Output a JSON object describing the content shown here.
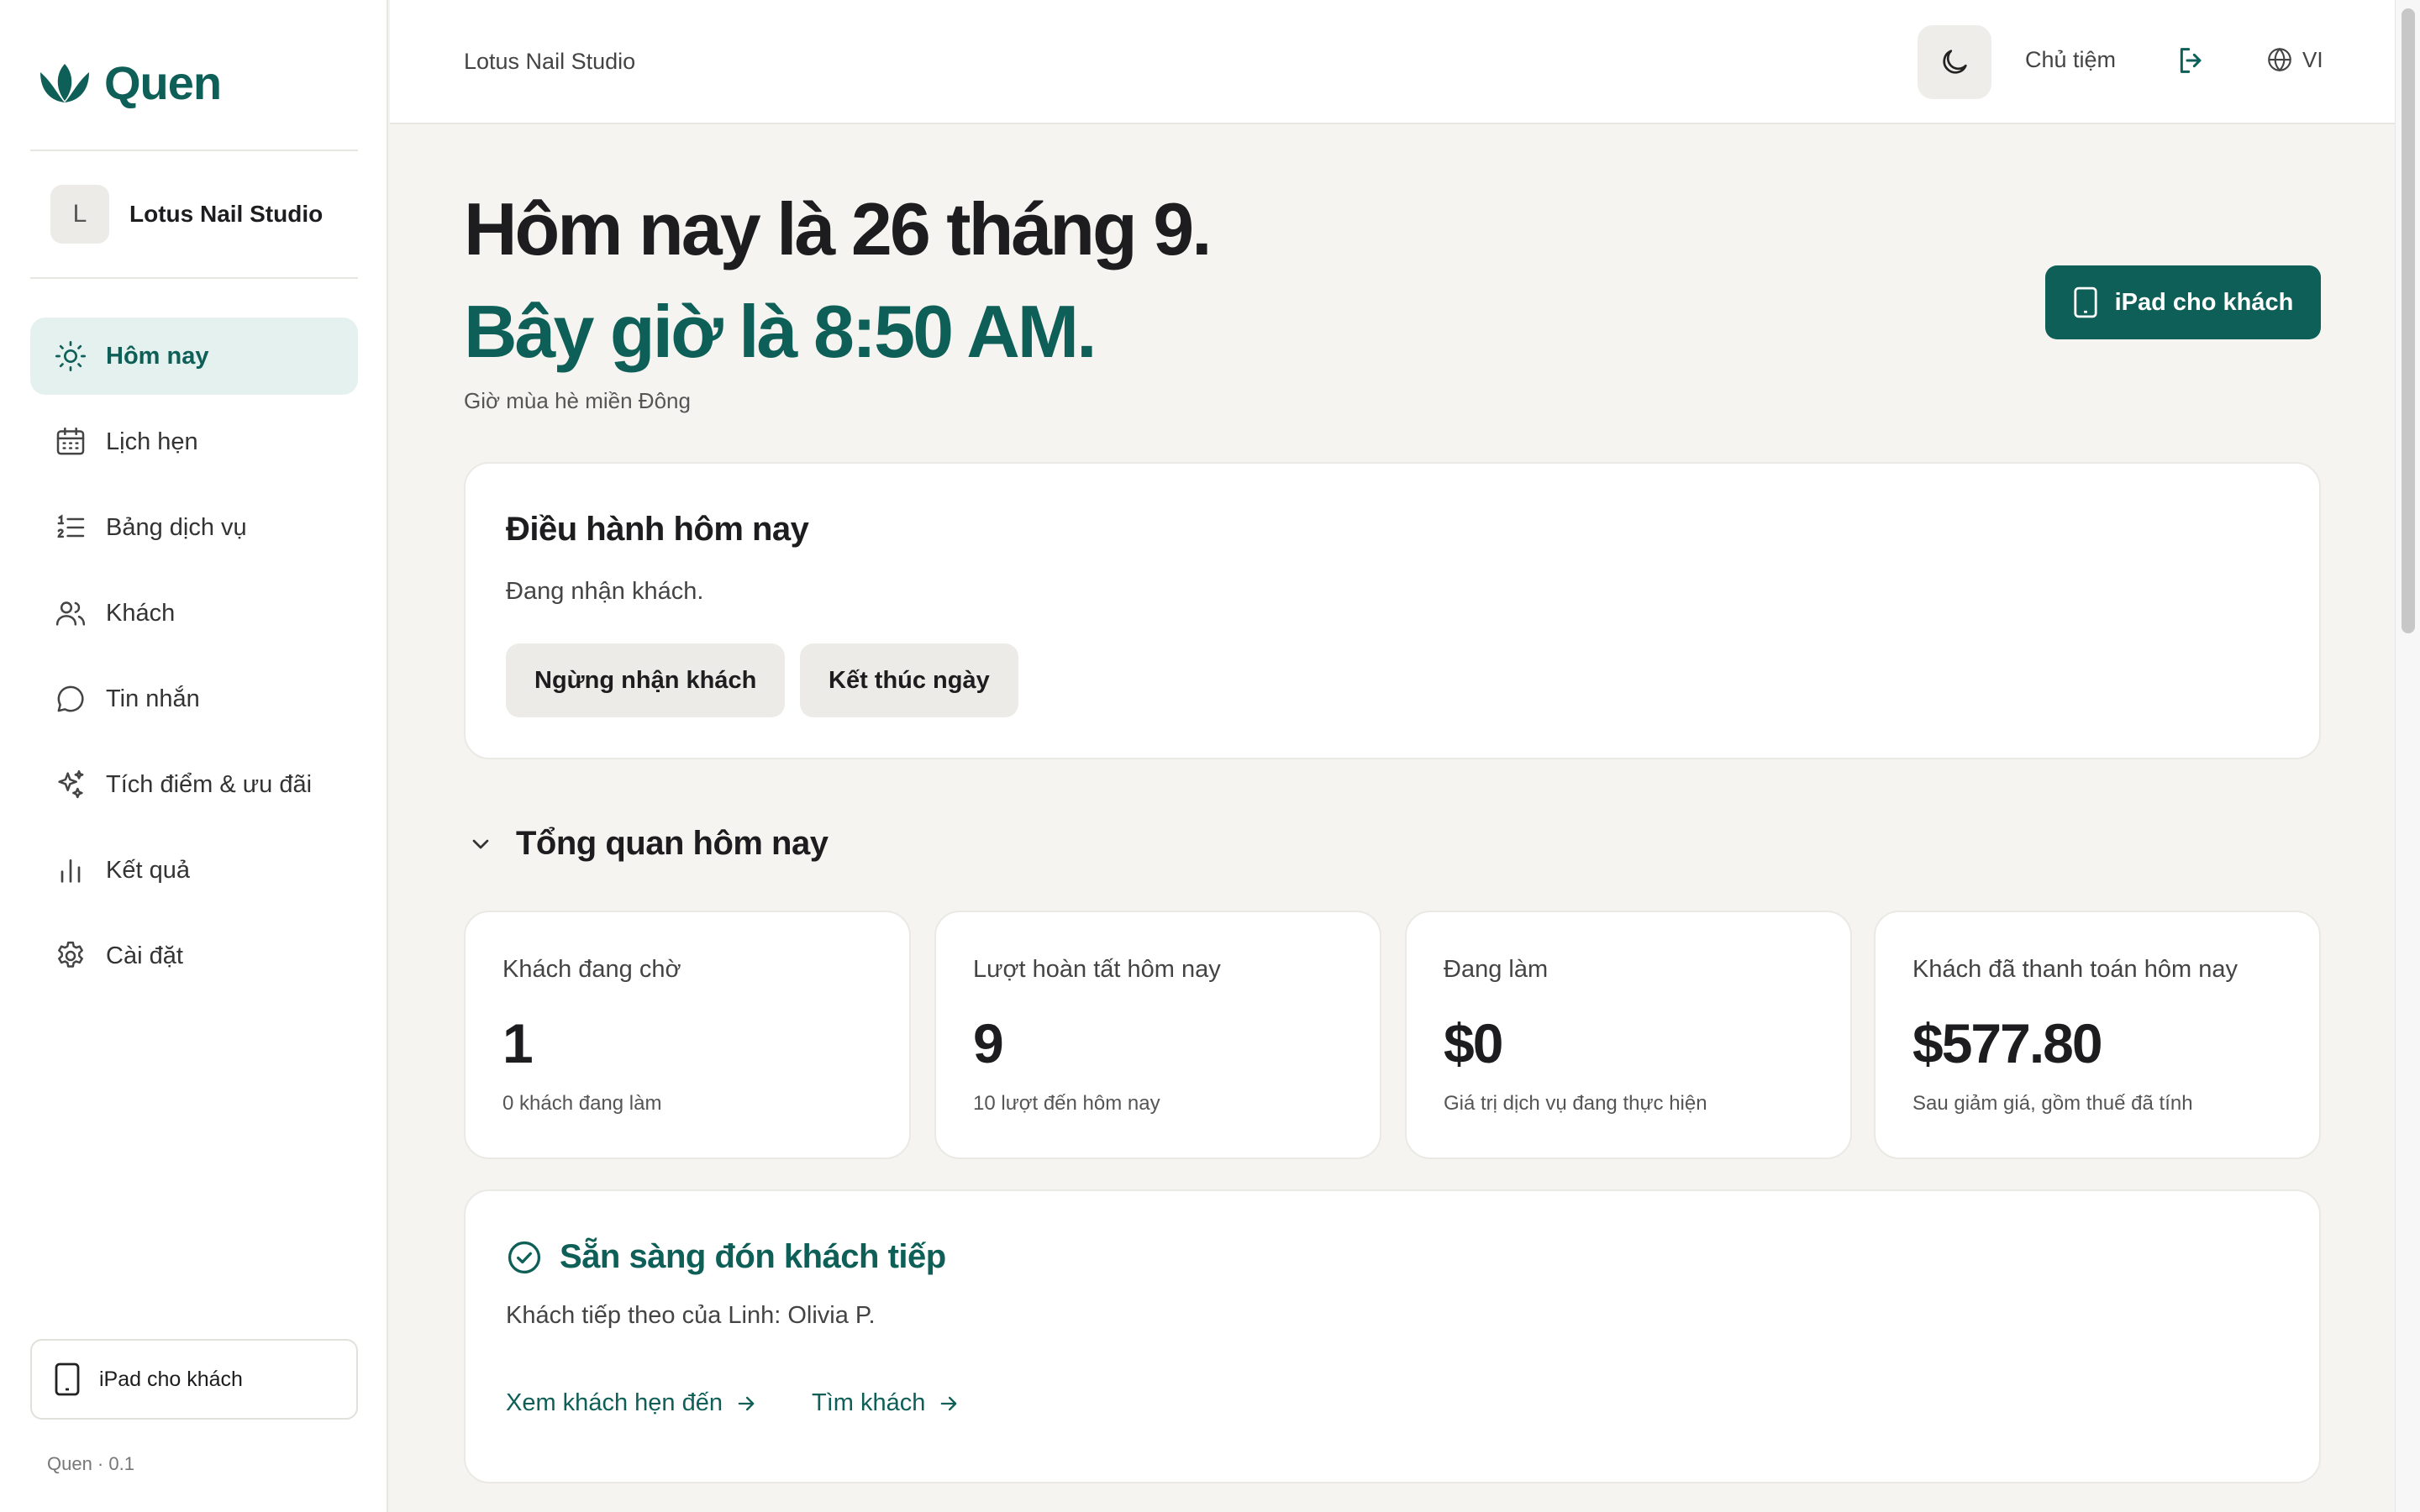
{
  "brand": {
    "name": "Quen",
    "color": "#0e5f57",
    "version": "Quen · 0.1"
  },
  "store": {
    "initial": "L",
    "name": "Lotus Nail Studio"
  },
  "sidebar": {
    "items": [
      {
        "label": "Hôm nay",
        "icon": "sun-icon",
        "active": true
      },
      {
        "label": "Lịch hẹn",
        "icon": "calendar-icon"
      },
      {
        "label": "Bảng dịch vụ",
        "icon": "list-ordered-icon"
      },
      {
        "label": "Khách",
        "icon": "users-icon"
      },
      {
        "label": "Tin nhắn",
        "icon": "message-icon"
      },
      {
        "label": "Tích điểm & ưu đãi",
        "icon": "sparkles-icon"
      },
      {
        "label": "Kết quả",
        "icon": "bar-chart-icon"
      },
      {
        "label": "Cài đặt",
        "icon": "gear-icon"
      }
    ],
    "ipad_label": "iPad cho khách"
  },
  "header": {
    "breadcrumb": "Lotus Nail Studio",
    "role": "Chủ tiệm",
    "language": "VI"
  },
  "main": {
    "date_line": "Hôm nay là 26 tháng 9.",
    "time_line": "Bây giờ là 8:50 AM.",
    "timezone": "Giờ mùa hè miền Đông",
    "ipad_button": "iPad cho khách",
    "operations": {
      "title": "Điều hành hôm nay",
      "status": "Đang nhận khách.",
      "stop_button": "Ngừng nhận khách",
      "end_button": "Kết thúc ngày"
    },
    "overview": {
      "title": "Tổng quan hôm nay",
      "stats": [
        {
          "label": "Khách đang chờ",
          "value": "1",
          "sub": "0 khách đang làm"
        },
        {
          "label": "Lượt hoàn tất hôm nay",
          "value": "9",
          "sub": "10 lượt đến hôm nay"
        },
        {
          "label": "Đang làm",
          "value": "$0",
          "sub": "Giá trị dịch vụ đang thực hiện"
        },
        {
          "label": "Khách đã thanh toán hôm nay",
          "value": "$577.80",
          "sub": "Sau giảm giá, gồm thuế đã tính"
        }
      ]
    },
    "ready": {
      "title": "Sẵn sàng đón khách tiếp",
      "desc": "Khách tiếp theo của Linh: Olivia P.",
      "link_appointments": "Xem khách hẹn đến",
      "link_find": "Tìm khách"
    }
  }
}
